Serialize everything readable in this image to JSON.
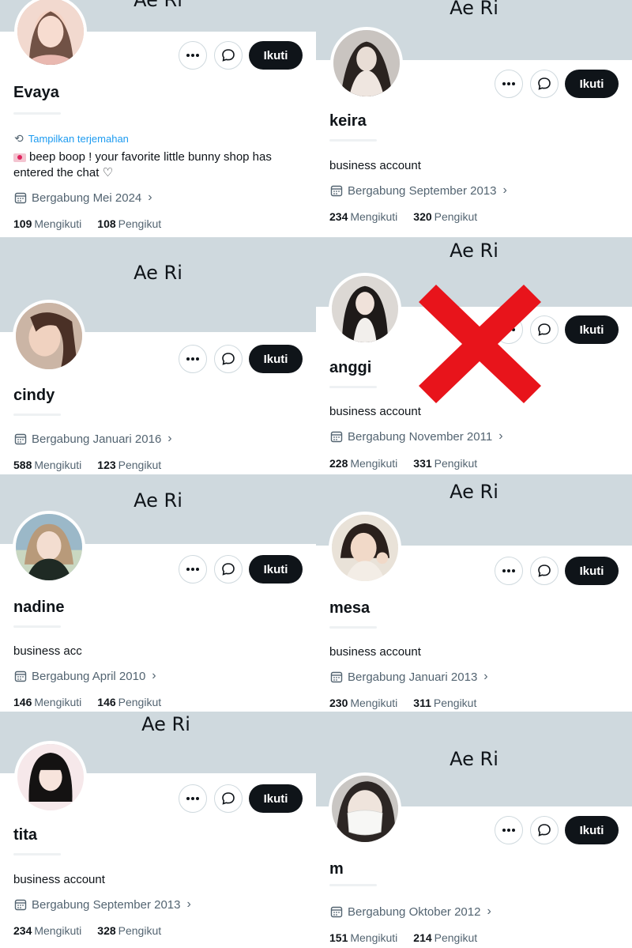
{
  "common": {
    "banner_text": "Ae Ri",
    "follow_label": "Ikuti",
    "following_label": "Mengikuti",
    "followers_label": "Pengikut",
    "more_icon": "more-dots-icon",
    "message_icon": "message-bubble-icon",
    "calendar_icon": "calendar-icon"
  },
  "profiles": [
    {
      "name": "Evaya",
      "translate_label": "Tampilkan terjemahan",
      "bio": "beep boop ! your favorite little bunny shop has entered the chat ♡",
      "joined": "Bergabung Mei 2024",
      "following": "109",
      "followers": "108"
    },
    {
      "name": "keira",
      "bio": "business account",
      "joined": "Bergabung September 2013",
      "following": "234",
      "followers": "320"
    },
    {
      "name": "cindy",
      "joined": "Bergabung Januari 2016",
      "following": "588",
      "followers": "123"
    },
    {
      "name": "anggi",
      "bio": "business account",
      "joined": "Bergabung November 2011",
      "following": "228",
      "followers": "331",
      "overlay": "red-x-mark"
    },
    {
      "name": "nadine",
      "bio": "business acc",
      "joined": "Bergabung April 2010",
      "following": "146",
      "followers": "146"
    },
    {
      "name": "mesa",
      "bio": "business account",
      "joined": "Bergabung Januari 2013",
      "following": "230",
      "followers": "311"
    },
    {
      "name": "tita",
      "bio": "business account",
      "joined": "Bergabung September 2013",
      "following": "234",
      "followers": "328"
    },
    {
      "name": "m",
      "joined": "Bergabung Oktober 2012",
      "following": "151",
      "followers": "214"
    }
  ],
  "colors": {
    "banner": "#cfd9de",
    "follow_button": "#0f1419",
    "link": "#1d9bf0",
    "secondary_text": "#536471",
    "x_mark": "#e8141b"
  }
}
